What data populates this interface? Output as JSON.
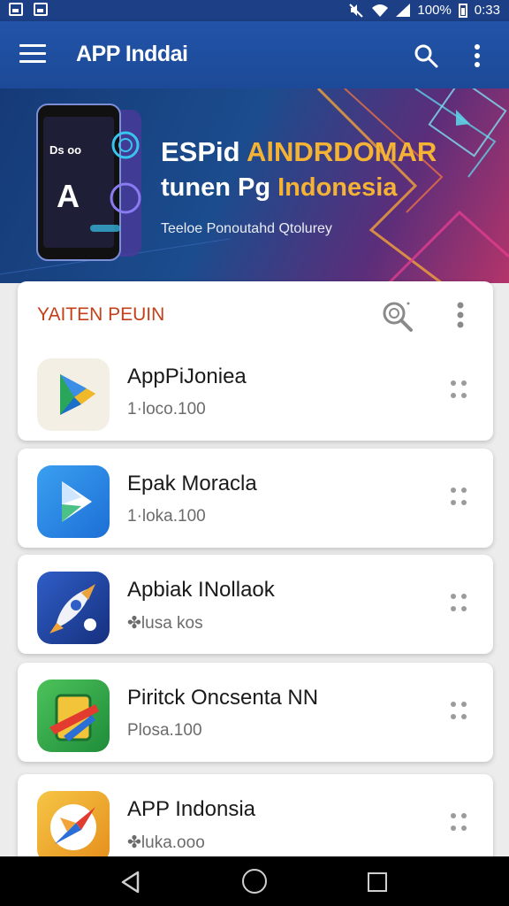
{
  "status_bar": {
    "battery": "100%",
    "time": "0:33",
    "icons": [
      "image-icon",
      "photo-icon",
      "mute-icon",
      "wifi-icon",
      "signal-icon",
      "battery-icon"
    ]
  },
  "app_bar": {
    "title": "APP Inddai",
    "icons": [
      "menu-icon",
      "search-icon",
      "more-vert-icon"
    ]
  },
  "banner": {
    "line1_a": "ESPid ",
    "line1_b": "AlNDRDOMAR",
    "line2_a": "tunen Pg ",
    "line2_b": "Indonesia",
    "subtitle": "Teeloe Ponoutahd Qtolurey",
    "phone_text": "Ds oo",
    "phone_letter": "A"
  },
  "section": {
    "title": "YAITEN PEUIN"
  },
  "apps": [
    {
      "name": "AppPiJoniea",
      "meta": "1·loco.100",
      "icon": "play-store-icon"
    },
    {
      "name": "Epak Moracla",
      "meta": "1·loka.100",
      "icon": "play-arrow-icon"
    },
    {
      "name": "Apbiak INollaok",
      "meta": "✤lusa kos",
      "icon": "rocket-icon"
    },
    {
      "name": "Piritck Oncsenta NN",
      "meta": "Plosa.100",
      "icon": "battery-app-icon"
    },
    {
      "name": "APP Indonsia",
      "meta": "✤luka.ooo",
      "icon": "compass-app-icon"
    }
  ],
  "colors": {
    "app_bar": "#2153a8",
    "section_title": "#c4401a",
    "banner_accent": "#f5b335"
  }
}
